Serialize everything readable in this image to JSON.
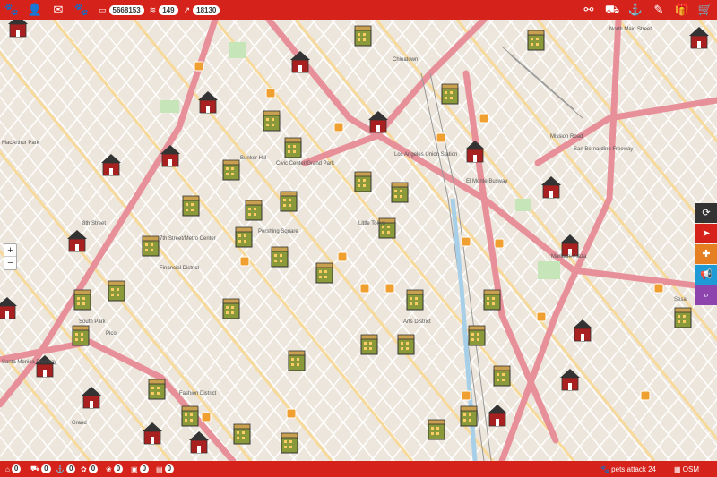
{
  "topbar": {
    "icons": [
      "paw-icon",
      "user-icon",
      "mail-icon",
      "pets-icon"
    ],
    "stats": [
      {
        "icon": "money-icon",
        "glyph": "▭",
        "value": "5668153"
      },
      {
        "icon": "wifi-icon",
        "glyph": "≋",
        "value": "149"
      },
      {
        "icon": "chart-icon",
        "glyph": "↗",
        "value": "18130"
      }
    ],
    "right_icons": [
      "binoculars-icon",
      "bag-icon",
      "anchor-icon",
      "pipette-icon",
      "gift-icon",
      "cart-icon"
    ]
  },
  "map": {
    "labels": [
      "MacArthur Park",
      "Chinatown",
      "Civic Center/Grand Park",
      "Bunker Hill",
      "Los Angeles Union Station",
      "7th Street/Metro Center",
      "Pershing Square",
      "Financial District",
      "Little Tokyo",
      "Arts District",
      "Fashion District",
      "South Park",
      "Santa Monica Freeway",
      "Grand",
      "8th Street",
      "Sesa",
      "Mariachi Plaza",
      "Pico",
      "North Main Street",
      "Mission Road",
      "El Monte Busway",
      "San Bernardino Freeway"
    ],
    "zoom_in": "+",
    "zoom_out": "−"
  },
  "sidebar_buttons": [
    {
      "icon": "refresh-icon",
      "glyph": "⟳",
      "color": "#333333"
    },
    {
      "icon": "locate-icon",
      "glyph": "➤",
      "color": "#d5231c"
    },
    {
      "icon": "plus-icon",
      "glyph": "✚",
      "color": "#e67e22"
    },
    {
      "icon": "megaphone-icon",
      "glyph": "📢",
      "color": "#1e9ad6"
    },
    {
      "icon": "search-icon",
      "glyph": "⌕",
      "color": "#8e44ad"
    }
  ],
  "bottombar": {
    "counts": [
      {
        "icon": "house-icon",
        "value": "0"
      },
      {
        "icon": "bag-icon",
        "value": "0"
      },
      {
        "icon": "anchor-icon",
        "value": "0"
      },
      {
        "icon": "paw-icon",
        "value": "0"
      },
      {
        "icon": "pets-icon",
        "value": "0"
      },
      {
        "icon": "briefcase-icon",
        "value": "0"
      },
      {
        "icon": "box-icon",
        "value": "0"
      }
    ],
    "attack_label": "pets attack 24",
    "map_source": "OSM"
  },
  "colors": {
    "brand": "#d5231c",
    "map_bg": "#ede6dc",
    "freeway": "#e8909a",
    "major_road": "#f7d99a"
  }
}
